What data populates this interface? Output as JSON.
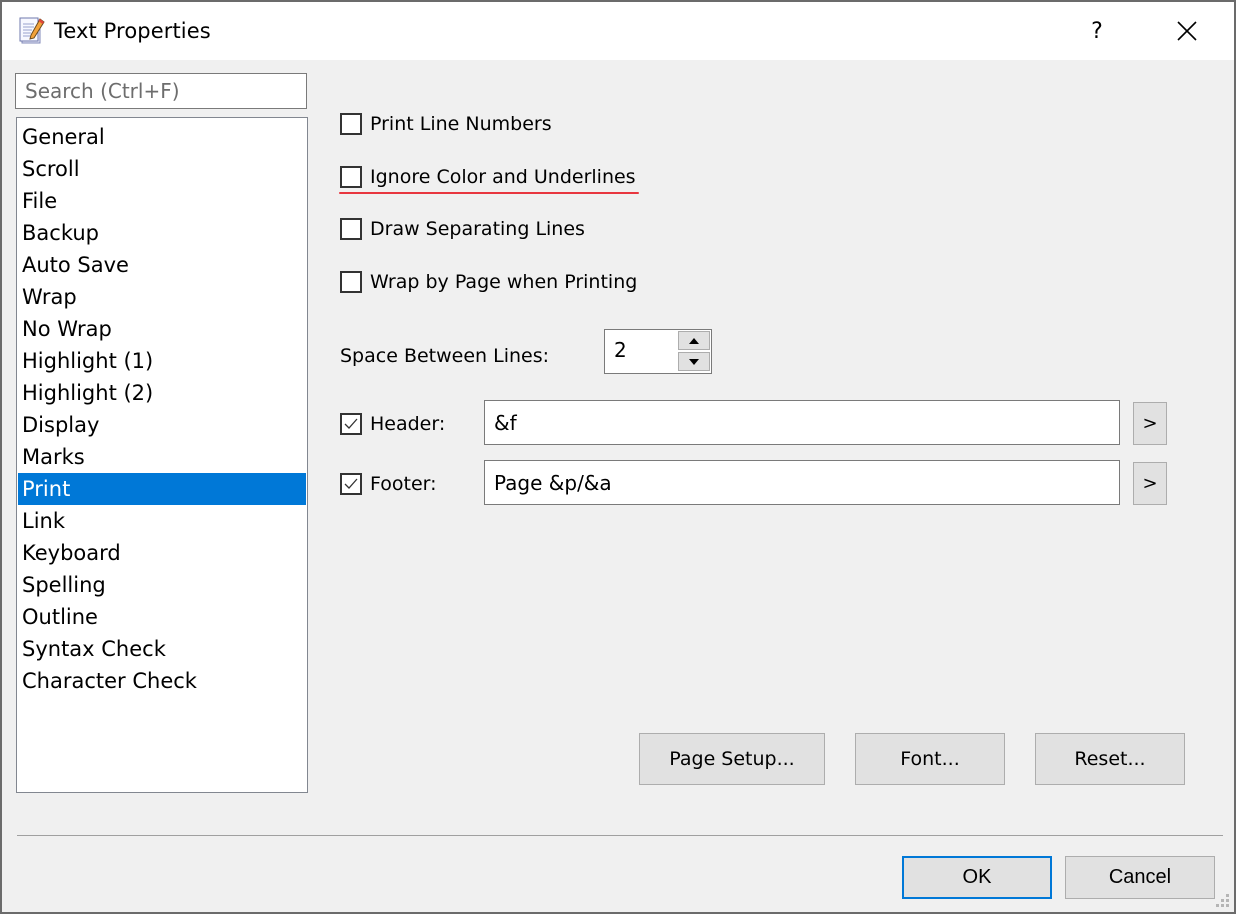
{
  "window": {
    "title": "Text Properties",
    "icon": "notepad-pencil-icon",
    "help_label": "?",
    "close_icon": "close-icon"
  },
  "sidebar": {
    "search_placeholder": "Search (Ctrl+F)",
    "search_value": "",
    "items": [
      {
        "label": "General",
        "selected": false
      },
      {
        "label": "Scroll",
        "selected": false
      },
      {
        "label": "File",
        "selected": false
      },
      {
        "label": "Backup",
        "selected": false
      },
      {
        "label": "Auto Save",
        "selected": false
      },
      {
        "label": "Wrap",
        "selected": false
      },
      {
        "label": "No Wrap",
        "selected": false
      },
      {
        "label": "Highlight (1)",
        "selected": false
      },
      {
        "label": "Highlight (2)",
        "selected": false
      },
      {
        "label": "Display",
        "selected": false
      },
      {
        "label": "Marks",
        "selected": false
      },
      {
        "label": "Print",
        "selected": true
      },
      {
        "label": "Link",
        "selected": false
      },
      {
        "label": "Keyboard",
        "selected": false
      },
      {
        "label": "Spelling",
        "selected": false
      },
      {
        "label": "Outline",
        "selected": false
      },
      {
        "label": "Syntax Check",
        "selected": false
      },
      {
        "label": "Character Check",
        "selected": false
      }
    ]
  },
  "print": {
    "options": [
      {
        "label": "Print Line Numbers",
        "checked": false
      },
      {
        "label": "Ignore Color and Underlines",
        "checked": false,
        "highlighted": true
      },
      {
        "label": "Draw Separating Lines",
        "checked": false
      },
      {
        "label": "Wrap by Page when Printing",
        "checked": false
      }
    ],
    "space_between_lines": {
      "label": "Space Between Lines:",
      "value": "2"
    },
    "header": {
      "label": "Header:",
      "checked": true,
      "value": "&f",
      "button": ">"
    },
    "footer": {
      "label": "Footer:",
      "checked": true,
      "value": "Page &p/&a",
      "button": ">"
    },
    "buttons": {
      "page_setup": "Page Setup...",
      "font": "Font...",
      "reset": "Reset..."
    }
  },
  "footer_buttons": {
    "ok": "OK",
    "cancel": "Cancel"
  },
  "colors": {
    "selection": "#0078d7",
    "highlight_underline": "#e8363f"
  }
}
